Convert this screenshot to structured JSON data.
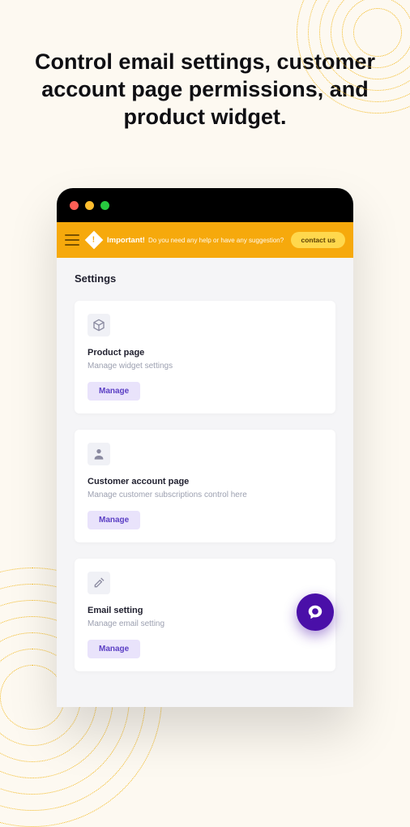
{
  "headline": "Control email settings, customer account page permissions, and product widget.",
  "banner": {
    "important": "Important!",
    "message": "Do you need any help or have any suggestion?",
    "contact": "contact us"
  },
  "page_title": "Settings",
  "cards": [
    {
      "title": "Product page",
      "subtitle": "Manage widget settings",
      "button": "Manage",
      "icon": "cube-icon"
    },
    {
      "title": "Customer account page",
      "subtitle": "Manage customer subscriptions control here",
      "button": "Manage",
      "icon": "user-icon"
    },
    {
      "title": "Email setting",
      "subtitle": "Manage email setting",
      "button": "Manage",
      "icon": "tools-icon"
    }
  ],
  "colors": {
    "accent": "#f6a90c",
    "fab": "#4a0fa8",
    "manage_bg": "#e9e3fb",
    "manage_fg": "#5b3fc4"
  }
}
